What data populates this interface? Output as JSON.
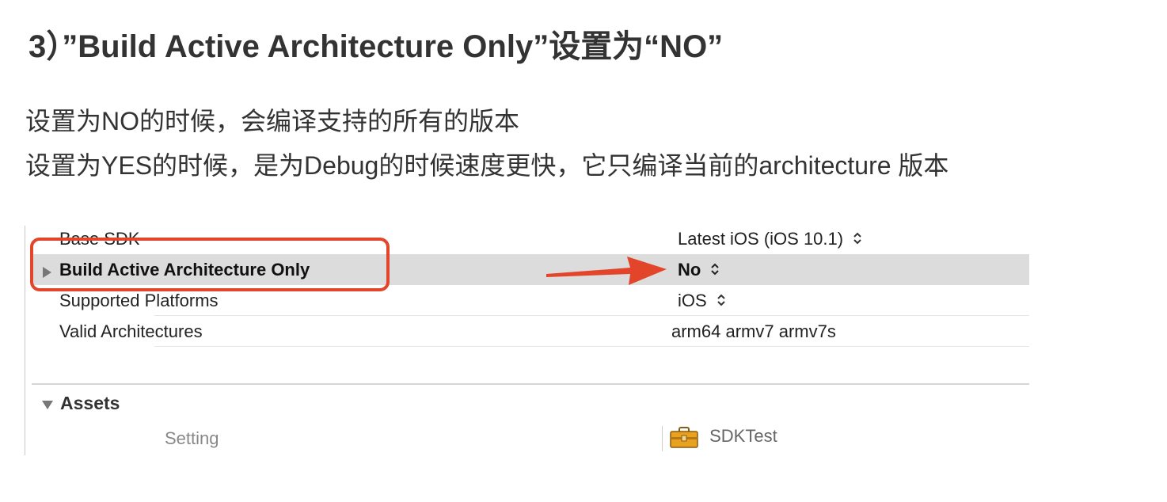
{
  "heading": "3）”Build Active Architecture Only”设置为“NO”",
  "paragraphs": [
    "设置为NO的时候，会编译支持的所有的版本",
    "设置为YES的时候，是为Debug的时候速度更快，它只编译当前的architecture 版本"
  ],
  "settings": {
    "rows": [
      {
        "key": "Base SDK",
        "value": "Latest iOS (iOS 10.1)"
      },
      {
        "key": "Build Active Architecture Only",
        "value": "No"
      },
      {
        "key": "Supported Platforms",
        "value": "iOS"
      },
      {
        "key": "Valid Architectures",
        "value": "arm64 armv7 armv7s"
      }
    ],
    "assets": {
      "title": "Assets",
      "setting_label": "Setting",
      "target_name": "SDKTest"
    }
  },
  "colors": {
    "highlight": "#e2452a",
    "selected_row": "#dcdcdc",
    "text": "#333333",
    "toolbox": "#e8a21f"
  },
  "icons": {
    "disclosure_collapsed": "triangle-right-icon",
    "disclosure_expanded": "triangle-down-icon",
    "stepper": "updown-chevron-icon",
    "target": "toolbox-icon",
    "annotation": "red-arrow-icon"
  }
}
